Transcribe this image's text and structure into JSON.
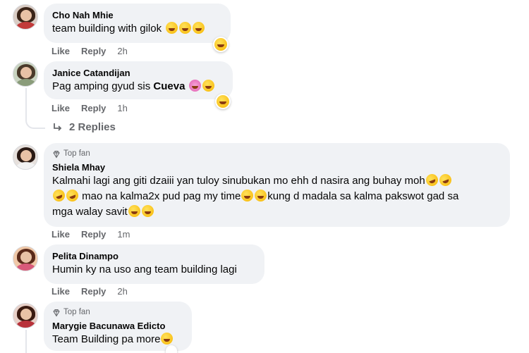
{
  "colors": {
    "bubble": "#f0f2f5",
    "meta": "#65676b",
    "text": "#050505"
  },
  "comments": [
    {
      "name": "Cho Nah Mhie",
      "text": "team building with gilok",
      "like": "Like",
      "reply": "Reply",
      "time": "2h"
    },
    {
      "name": "Janice Catandijan",
      "text_before": "Pag amping gyud sis ",
      "mention": "Cueva",
      "like": "Like",
      "reply": "Reply",
      "time": "1h",
      "replies_label": "2 Replies"
    },
    {
      "badge": "Top fan",
      "name": "Shiela Mhay",
      "line1": "Kalmahi lagi ang giti dzaiii yan tuloy sinubukan mo ehh d nasira ang buhay moh",
      "line2a": "mao na kalma2x pud pag my time",
      "line2b": "kung d madala sa kalma pakswot gad sa",
      "line3": "mga walay savit",
      "like": "Like",
      "reply": "Reply",
      "time": "1m"
    },
    {
      "name": "Pelita Dinampo",
      "text": "Humin ky na uso ang team building lagi",
      "like": "Like",
      "reply": "Reply",
      "time": "2h"
    },
    {
      "badge": "Top fan",
      "name": "Marygie Bacunawa Edicto",
      "text": "Team Building pa more"
    }
  ]
}
